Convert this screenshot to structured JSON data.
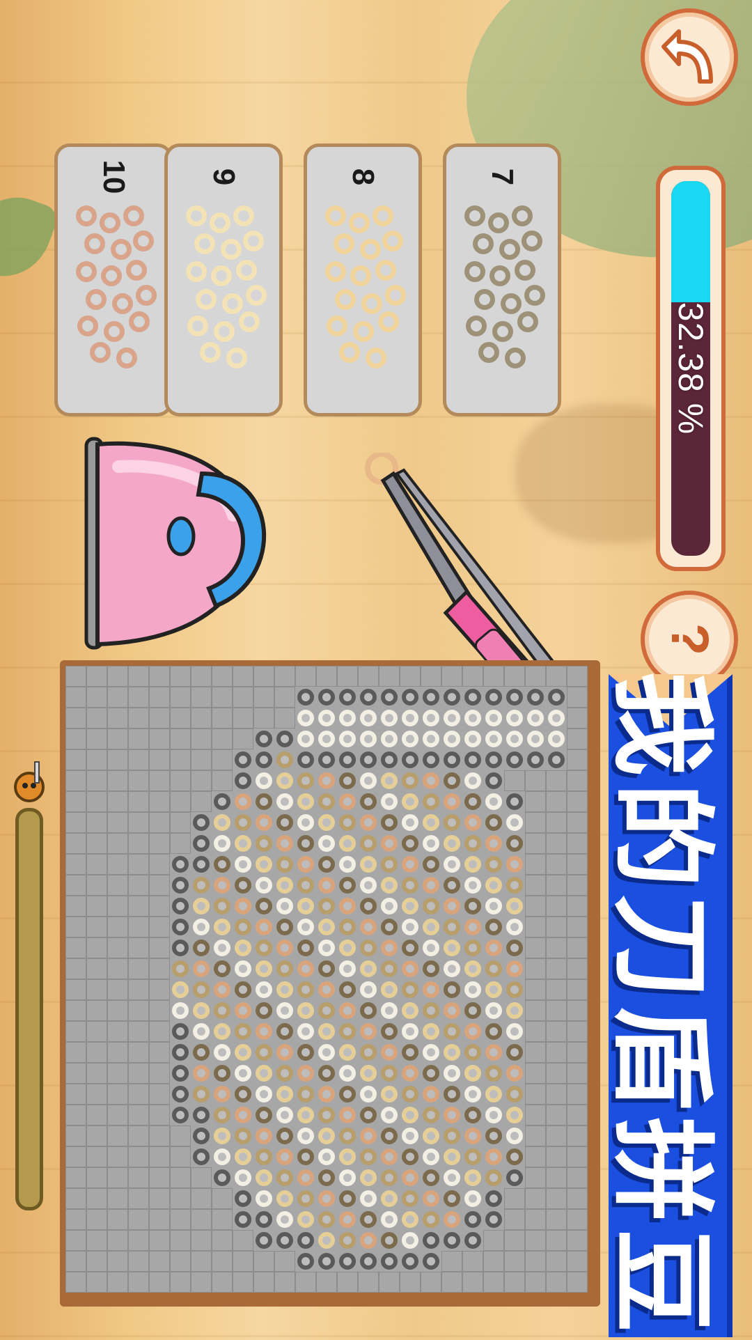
{
  "header": {
    "back_icon": "curved-arrow-up-icon",
    "help_label": "?",
    "progress": {
      "value_percent": 32.38,
      "label": "32.38 %"
    }
  },
  "palette_cards": [
    {
      "number": "10",
      "bead_color": "#d9a48a"
    },
    {
      "number": "9",
      "bead_color": "#f3e2b6"
    },
    {
      "number": "8",
      "bead_color": "#f0d49c"
    },
    {
      "number": "7",
      "bead_color": "#9d9177"
    }
  ],
  "tools": {
    "iron_icon": "iron-icon",
    "tweezers_icon": "tweezers-icon"
  },
  "banner": {
    "title": "我的刀盾拼豆"
  },
  "colors": {
    "accent": "#1b4fe0",
    "progress_fill": "#18d8f2",
    "progress_track": "#5b2637"
  }
}
